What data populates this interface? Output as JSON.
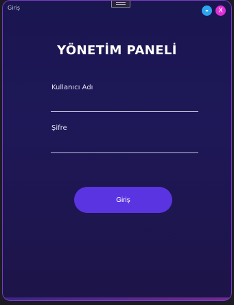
{
  "window": {
    "title": "Giriş",
    "minimize_label": "-",
    "close_label": "X"
  },
  "heading": "YÖNETİM PANELİ",
  "form": {
    "username_label": "Kullanıcı Adı",
    "username_value": "",
    "password_label": "Şifre",
    "password_value": "",
    "submit_label": "Giriş"
  },
  "colors": {
    "background_top": "#1a1650",
    "background_bottom": "#1d1448",
    "border": "#7a3ec2",
    "minimize_button": "#2ea3ee",
    "close_button": "#dc2fd4",
    "submit_button": "#5a34e0"
  },
  "icons": {
    "drag_handle": "drag-handle-icon"
  }
}
